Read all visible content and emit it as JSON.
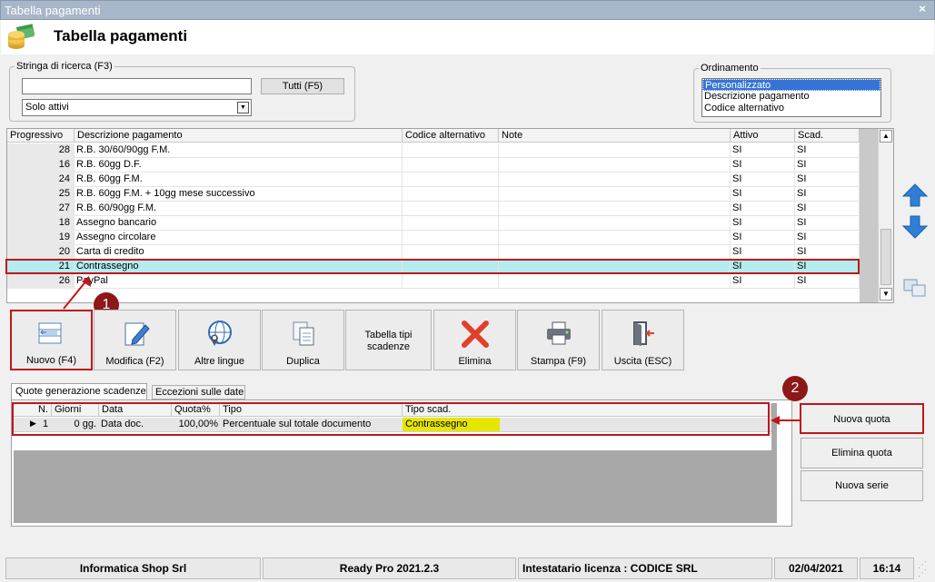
{
  "window": {
    "title": "Tabella pagamenti",
    "close_glyph": "×"
  },
  "header": {
    "title": "Tabella pagamenti"
  },
  "search": {
    "group_label": "Stringa di ricerca (F3)",
    "value": "",
    "all_button": "Tutti (F5)",
    "filter_value": "Solo attivi"
  },
  "sort": {
    "group_label": "Ordinamento",
    "options": [
      "Personalizzato",
      "Descrizione pagamento",
      "Codice alternativo"
    ]
  },
  "table": {
    "columns": [
      "Progressivo",
      "Descrizione pagamento",
      "Codice alternativo",
      "Note",
      "Attivo",
      "Scad."
    ],
    "rows": [
      {
        "prog": "28",
        "desc": "R.B. 30/60/90gg F.M.",
        "cod": "",
        "note": "",
        "attivo": "SI",
        "scad": "SI"
      },
      {
        "prog": "16",
        "desc": "R.B. 60gg D.F.",
        "cod": "",
        "note": "",
        "attivo": "SI",
        "scad": "SI"
      },
      {
        "prog": "24",
        "desc": "R.B. 60gg F.M.",
        "cod": "",
        "note": "",
        "attivo": "SI",
        "scad": "SI"
      },
      {
        "prog": "25",
        "desc": "R.B. 60gg F.M. + 10gg mese successivo",
        "cod": "",
        "note": "",
        "attivo": "SI",
        "scad": "SI"
      },
      {
        "prog": "27",
        "desc": "R.B. 60/90gg F.M.",
        "cod": "",
        "note": "",
        "attivo": "SI",
        "scad": "SI"
      },
      {
        "prog": "18",
        "desc": "Assegno bancario",
        "cod": "",
        "note": "",
        "attivo": "SI",
        "scad": "SI"
      },
      {
        "prog": "19",
        "desc": "Assegno circolare",
        "cod": "",
        "note": "",
        "attivo": "SI",
        "scad": "SI"
      },
      {
        "prog": "20",
        "desc": "Carta di credito",
        "cod": "",
        "note": "",
        "attivo": "SI",
        "scad": "SI"
      },
      {
        "prog": "21",
        "desc": "Contrassegno",
        "cod": "",
        "note": "",
        "attivo": "SI",
        "scad": "SI"
      },
      {
        "prog": "26",
        "desc": "PayPal",
        "cod": "",
        "note": "",
        "attivo": "SI",
        "scad": "SI"
      }
    ]
  },
  "toolbar": {
    "nuovo": "Nuovo (F4)",
    "modifica": "Modifica (F2)",
    "lingue": "Altre lingue",
    "duplica": "Duplica",
    "tipi_line1": "Tabella tipi",
    "tipi_line2": "scadenze",
    "elimina": "Elimina",
    "stampa": "Stampa (F9)",
    "uscita": "Uscita (ESC)"
  },
  "tabs": [
    "Quote generazione scadenze",
    "Eccezioni sulle date"
  ],
  "quote": {
    "columns": [
      "N.",
      "Giorni",
      "Data",
      "Quota%",
      "Tipo",
      "Tipo scad."
    ],
    "row": {
      "n": "1",
      "giorni": "0 gg.",
      "data": "Data doc.",
      "quota": "100,00%",
      "tipo": "Percentuale sul totale documento",
      "tipo_scad": "Contrassegno"
    }
  },
  "side_buttons": {
    "nuova_quota": "Nuova quota",
    "elimina_quota": "Elimina quota",
    "nuova_serie": "Nuova serie"
  },
  "callouts": {
    "one": "1",
    "two": "2"
  },
  "status": {
    "company": "Informatica Shop Srl",
    "version": "Ready Pro 2021.2.3",
    "license": "Intestatario licenza : CODICE SRL",
    "date": "02/04/2021",
    "time": "16:14"
  },
  "colors": {
    "highlight_border": "#c0161a",
    "selected_row": "#b4ecef",
    "yellow_cell": "#e6e600",
    "arrow_blue": "#2f7fd6"
  }
}
